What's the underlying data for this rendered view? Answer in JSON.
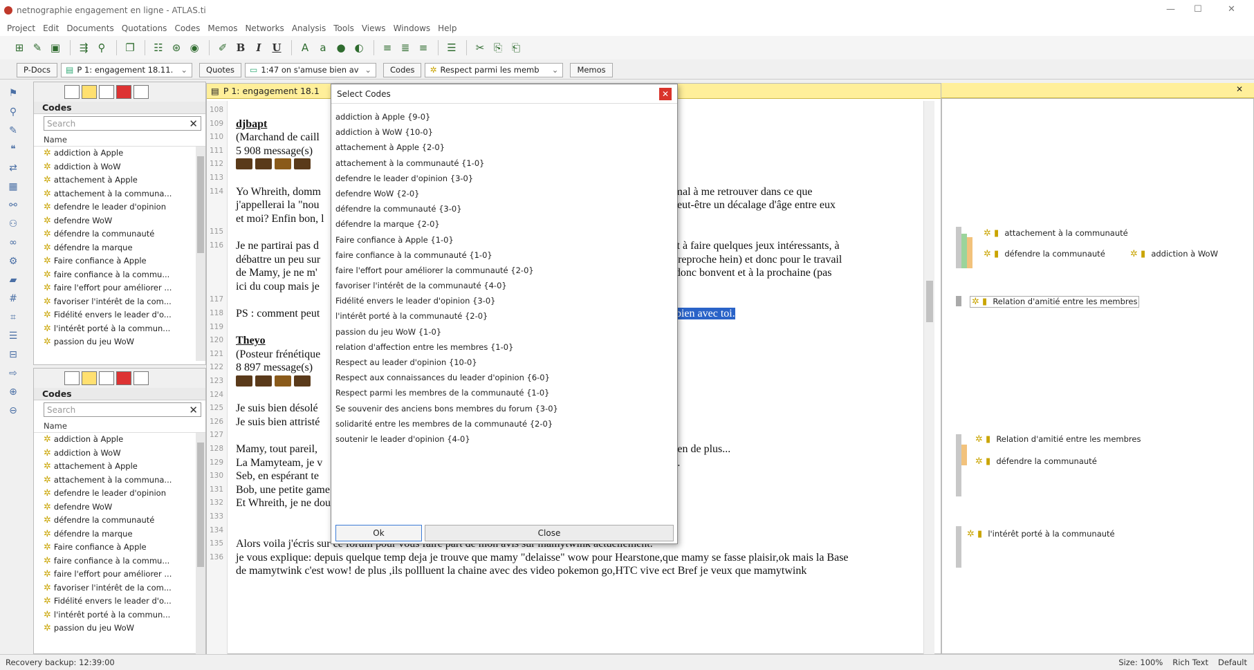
{
  "window": {
    "title": "netnographie engagement en ligne - ATLAS.ti"
  },
  "menu": [
    "Project",
    "Edit",
    "Documents",
    "Quotations",
    "Codes",
    "Memos",
    "Networks",
    "Analysis",
    "Tools",
    "Views",
    "Windows",
    "Help"
  ],
  "selectors": {
    "pdocs_label": "P-Docs",
    "pdocs_value": "P 1: engagement 18.11.",
    "quotes_label": "Quotes",
    "quotes_value": "1:47 on s'amuse bien av",
    "codes_label": "Codes",
    "codes_value": "Respect parmi les memb",
    "memos_label": "Memos"
  },
  "code_panel": {
    "title": "Codes",
    "search_placeholder": "Search",
    "column": "Name",
    "items": [
      "addiction à Apple",
      "addiction à WoW",
      "attachement à Apple",
      "attachement à la communa...",
      "defendre le leader d'opinion",
      "defendre WoW",
      "défendre la communauté",
      "défendre la marque",
      "Faire confiance à Apple",
      "faire confiance à la commu...",
      "faire l'effort pour améliorer ...",
      "favoriser l'intérêt de la com...",
      "Fidélité envers le leader d'o...",
      "l'intérêt porté à la commun...",
      "passion du jeu WoW"
    ]
  },
  "document": {
    "tab_title": "P 1: engagement 18.1",
    "lines": [
      {
        "n": "108",
        "t": ""
      },
      {
        "n": "109",
        "t": "djbapt",
        "style": "author"
      },
      {
        "n": "110",
        "t": "(Marchand de caill"
      },
      {
        "n": "111",
        "t": "5 908 message(s)"
      },
      {
        "n": "112",
        "t": "",
        "icons": true
      },
      {
        "n": "113",
        "t": ""
      },
      {
        "n": "114",
        "t": "Yo Whreith, domm"
      },
      {
        "n": "",
        "t": "j'appellerai la \"nou"
      },
      {
        "n": "",
        "t": "et moi? Enfin bon, l"
      },
      {
        "n": "115",
        "t": ""
      },
      {
        "n": "116",
        "t": "Je ne partirai pas d"
      },
      {
        "n": "",
        "t": "débattre un peu sur"
      },
      {
        "n": "",
        "t": "de Mamy, je ne m'"
      },
      {
        "n": "",
        "t": "ici du coup mais je"
      },
      {
        "n": "117",
        "t": ""
      },
      {
        "n": "118",
        "t": "PS : comment peut"
      },
      {
        "n": "119",
        "t": ""
      },
      {
        "n": "120",
        "t": "Theyo",
        "style": "author"
      },
      {
        "n": "121",
        "t": "(Posteur frénétique"
      },
      {
        "n": "122",
        "t": "8 897 message(s)"
      },
      {
        "n": "123",
        "t": "",
        "icons": true
      },
      {
        "n": "124",
        "t": ""
      },
      {
        "n": "125",
        "t": "Je suis bien désolé"
      },
      {
        "n": "126",
        "t": "Je suis bien attristé"
      },
      {
        "n": "127",
        "t": ""
      },
      {
        "n": "128",
        "t": "Mamy, tout pareil,"
      },
      {
        "n": "129",
        "t": "La Mamyteam, je v"
      },
      {
        "n": "130",
        "t": "Seb, en espérant te"
      },
      {
        "n": "131",
        "t": "Bob, une petite game sur lol d'ici peu !"
      },
      {
        "n": "132",
        "t": "Et Whreith, je ne doute pas te recroiser sur Skype."
      },
      {
        "n": "133",
        "t": ""
      },
      {
        "n": "134",
        "t": ""
      },
      {
        "n": "135",
        "t": "Alors voila j'écris sur ce forum pour vous faire part de mon avis sur mamytwink actuellement."
      },
      {
        "n": "136",
        "t": "je vous explique: depuis quelque temp deja je trouve que mamy \"delaisse\" wow pour Hearstone,que mamy se fasse plaisir,ok mais la Base"
      },
      {
        "n": "",
        "t": "de mamytwink c'est wow! de plus ,ils pollluent la chaine avec des video pokemon go,HTC vive ect Bref je veux que mamytwink"
      }
    ],
    "right_fragments": [
      {
        "line": 6,
        "t": "ai aussi du mal à me retrouver dans ce que"
      },
      {
        "line": 7,
        "t": "ps révolu. Peut-être un décalage d'âge entre eux"
      },
      {
        "line": 10,
        "t": "s, a troller et à faire quelques jeux intéressants, à"
      },
      {
        "line": 11,
        "t": "c'est pas un reproche hein) et donc pour le travail"
      },
      {
        "line": 12,
        "t": "te souhaite donc bonvent et à la prochaine (pas"
      },
      {
        "line": 15,
        "t": "on s'amuse bien avec toi.",
        "hl": true
      },
      {
        "line": 25,
        "t": "taverne et rien de plus..."
      },
      {
        "line": 26,
        "t": "pas une joie."
      }
    ]
  },
  "margin_codes": [
    {
      "label": "attachement à la communauté",
      "row": 1
    },
    {
      "label": "défendre la communauté",
      "row": 2
    },
    {
      "label": "addiction à WoW",
      "row": 2,
      "col2": true
    },
    {
      "label": "Relation d'amitié entre les membres",
      "row": 3
    },
    {
      "label": "Relation d'amitié entre les membres",
      "row": 4
    },
    {
      "label": "défendre la communauté",
      "row": 5
    },
    {
      "label": "l'intérêt porté à la communauté",
      "row": 6
    }
  ],
  "dialog": {
    "title": "Select Codes",
    "items": [
      "addiction à Apple {9-0}",
      "addiction à WoW {10-0}",
      "attachement à Apple {2-0}",
      "attachement à la communauté {1-0}",
      "defendre le leader d'opinion {3-0}",
      "defendre WoW {2-0}",
      "défendre la communauté {3-0}",
      "défendre la marque {2-0}",
      "Faire confiance à Apple {1-0}",
      "faire confiance à la communauté {1-0}",
      "faire l'effort pour améliorer la communauté {2-0}",
      "favoriser l'intérêt de la communauté {4-0}",
      "Fidélité envers le leader d'opinion {3-0}",
      "l'intérêt porté à la communauté {2-0}",
      "passion du jeu WoW {1-0}",
      "relation d'affection entre les membres {1-0}",
      "Respect au leader d'opinion {10-0}",
      "Respect aux connaissances du leader d'opinion {6-0}",
      "Respect parmi les membres de la communauté {1-0}",
      "Se souvenir des anciens bons membres du forum {3-0}",
      "solidarité entre les membres de la communauté {2-0}",
      "soutenir le leader d'opinion {4-0}"
    ],
    "ok": "Ok",
    "close": "Close"
  },
  "status": {
    "left": "Recovery backup: 12:39:00",
    "size": "Size: 100%",
    "format": "Rich Text",
    "default": "Default"
  }
}
